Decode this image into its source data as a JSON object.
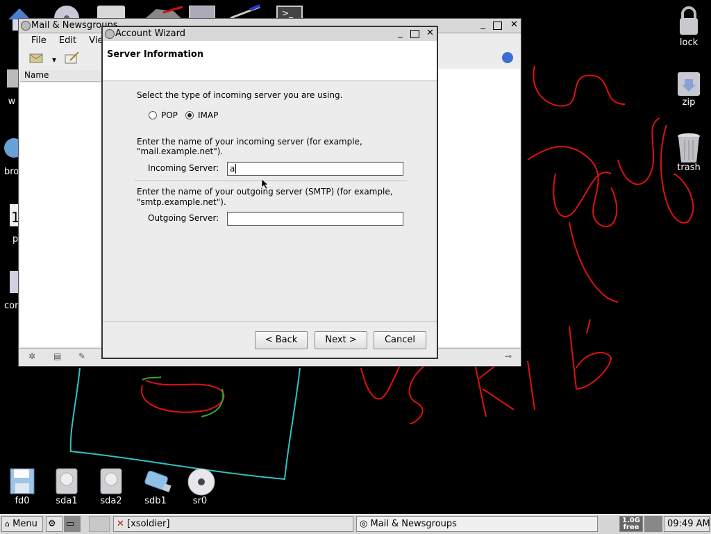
{
  "desktop": {
    "left_icons": [
      {
        "name": "w"
      },
      {
        "name": "bro"
      },
      {
        "name": "p"
      },
      {
        "name": "con"
      }
    ],
    "right_icons": [
      {
        "name": "lock"
      },
      {
        "name": "zip"
      },
      {
        "name": "trash"
      }
    ],
    "bottom_icons": [
      {
        "name": "fd0"
      },
      {
        "name": "sda1"
      },
      {
        "name": "sda2"
      },
      {
        "name": "sdb1"
      },
      {
        "name": "sr0"
      }
    ]
  },
  "mail_window": {
    "title": "Mail & Newsgroups",
    "menu": [
      "File",
      "Edit",
      "View"
    ],
    "column_header": "Name"
  },
  "wizard": {
    "title": "Account Wizard",
    "heading": "Server Information",
    "server_type_prompt": "Select the type of incoming server you are using.",
    "radio_pop": "POP",
    "radio_imap": "IMAP",
    "selected": "IMAP",
    "incoming_prompt_1": "Enter the name of your incoming server (for example,",
    "incoming_prompt_2": "\"mail.example.net\").",
    "incoming_label": "Incoming Server:",
    "incoming_value": "a",
    "outgoing_prompt_1": "Enter the name of your outgoing server (SMTP) (for example,",
    "outgoing_prompt_2": "\"smtp.example.net\").",
    "outgoing_label": "Outgoing Server:",
    "outgoing_value": "",
    "back_button": "< Back",
    "next_button": "Next >",
    "cancel_button": "Cancel"
  },
  "taskbar": {
    "menu_label": "Menu",
    "task_xsoldier": "[xsoldier]",
    "task_mail": "Mail & Newsgroups",
    "memory_top": "1.0G",
    "memory_bottom": "free",
    "clock": "09:49 AM"
  }
}
